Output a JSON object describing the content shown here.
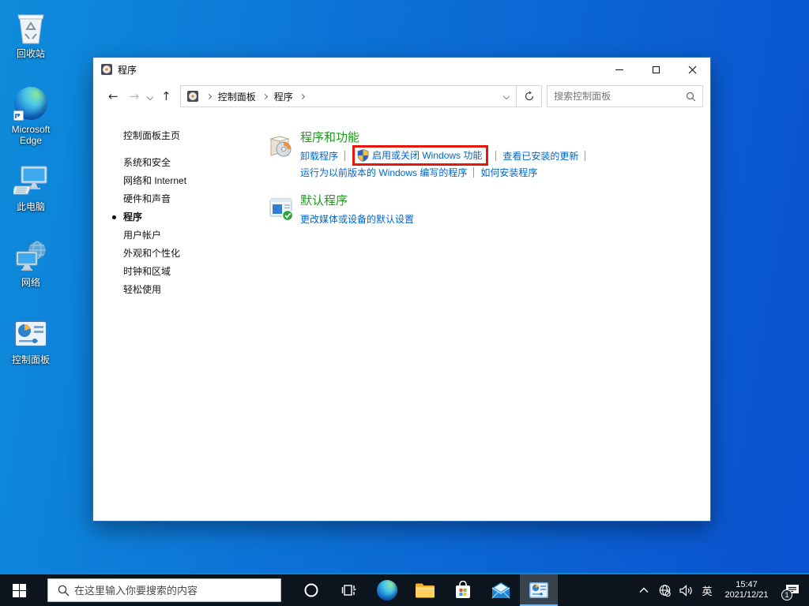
{
  "desktop": {
    "icons": [
      {
        "name": "recycle-bin",
        "label": "回收站"
      },
      {
        "name": "microsoft-edge",
        "label": "Microsoft Edge"
      },
      {
        "name": "this-pc",
        "label": "此电脑"
      },
      {
        "name": "network",
        "label": "网络"
      },
      {
        "name": "control-panel",
        "label": "控制面板"
      }
    ]
  },
  "window": {
    "title": "程序",
    "breadcrumb": {
      "root_icon": "control-panel-icon",
      "items": [
        "控制面板",
        "程序"
      ]
    },
    "search": {
      "placeholder": "搜索控制面板"
    },
    "sidebar": {
      "home": "控制面板主页",
      "items": [
        {
          "label": "系统和安全"
        },
        {
          "label": "网络和 Internet"
        },
        {
          "label": "硬件和声音"
        },
        {
          "label": "程序",
          "current": true
        },
        {
          "label": "用户帐户"
        },
        {
          "label": "外观和个性化"
        },
        {
          "label": "时钟和区域"
        },
        {
          "label": "轻松使用"
        }
      ]
    },
    "sections": [
      {
        "title": "程序和功能",
        "icon": "programs-features-icon",
        "row1": [
          "卸载程序",
          "启用或关闭 Windows 功能",
          "查看已安装的更新"
        ],
        "row1_highlighted": "启用或关闭 Windows 功能",
        "row2": [
          "运行为以前版本的 Windows 编写的程序",
          "如何安装程序"
        ]
      },
      {
        "title": "默认程序",
        "icon": "default-programs-icon",
        "row1": [
          "更改媒体或设备的默认设置"
        ]
      }
    ]
  },
  "taskbar": {
    "search": {
      "placeholder": "在这里输入你要搜索的内容"
    },
    "apps": [
      "start",
      "cortana",
      "task-view",
      "edge",
      "file-explorer",
      "store",
      "mail",
      "control-panel"
    ],
    "active_app": "control-panel",
    "tray": {
      "ime": "英",
      "time": "15:47",
      "date": "2021/12/21",
      "notification_count": "1"
    }
  },
  "icons": {
    "uac-shield": "blue-yellow quadrant shield",
    "search": "magnifier",
    "refresh": "circular arrow",
    "network-tray": "globe with no-internet mark",
    "volume-tray": "speaker with waves"
  },
  "colors": {
    "desktop_blue_left": "#0e8cdb",
    "desktop_blue_right": "#0a51cf",
    "heading_green": "#1f9a1f",
    "link_blue": "#0066cc",
    "highlight_red": "#e8150c",
    "taskbar_bg": "#0c141d",
    "taskbar_accent": "#0d85dc"
  }
}
